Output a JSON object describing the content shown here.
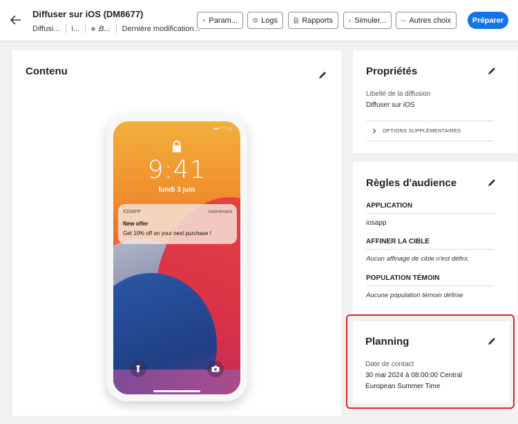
{
  "header": {
    "title": "Diffuser sur iOS (DM8677)",
    "meta": [
      "Diffusi...",
      "i...",
      "B...",
      "Dernière modification..."
    ],
    "buttons": {
      "params": "Param...",
      "logs": "Logs",
      "reports": "Rapports",
      "simulate": "Simuler...",
      "more": "Autres choix",
      "prepare": "Préparer"
    }
  },
  "content": {
    "title": "Contenu",
    "phone": {
      "time": "9:41",
      "date": "lundi 3 juin",
      "notification": {
        "app": "IOSAPP",
        "when": "maintenant",
        "title": "New offer",
        "body": "Get 10% off on your next purchase !"
      }
    }
  },
  "properties": {
    "title": "Propriétés",
    "label": "Libellé de la diffusion",
    "value": "Diffuser sur iOS",
    "more_options": "OPTIONS SUPPLÉMENTAIRES"
  },
  "audience": {
    "title": "Règles d'audience",
    "app_section": "APPLICATION",
    "app_value": "iosapp",
    "refine_section": "AFFINER LA CIBLE",
    "refine_value": "Aucun affinage de cible n'est défini.",
    "control_section": "POPULATION TÉMOIN",
    "control_value": "Aucune population témoin définie"
  },
  "planning": {
    "title": "Planning",
    "label": "Date de contact",
    "value_line1": "30 mai 2024 à 08:00:00 Central",
    "value_line2": "European Summer Time"
  },
  "colors": {
    "accent": "#1473e6",
    "highlight": "#d72a2a"
  }
}
